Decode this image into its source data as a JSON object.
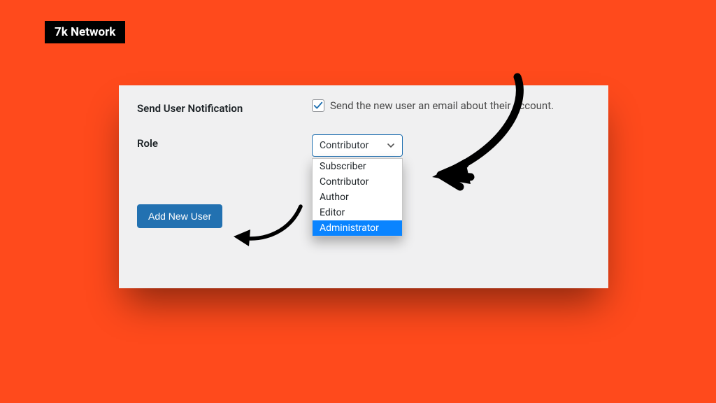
{
  "brand": "7k Network",
  "form": {
    "notification_label": "Send User Notification",
    "notification_text": "Send the new user an email about their account.",
    "notification_checked": true,
    "role_label": "Role",
    "role_selected": "Contributor",
    "role_options": [
      "Subscriber",
      "Contributor",
      "Author",
      "Editor",
      "Administrator"
    ],
    "role_highlighted_index": 4,
    "submit_label": "Add New User"
  },
  "colors": {
    "background": "#ff4a1c",
    "panel": "#f0f0f1",
    "primary": "#2271b1",
    "highlight": "#0a84ff"
  }
}
